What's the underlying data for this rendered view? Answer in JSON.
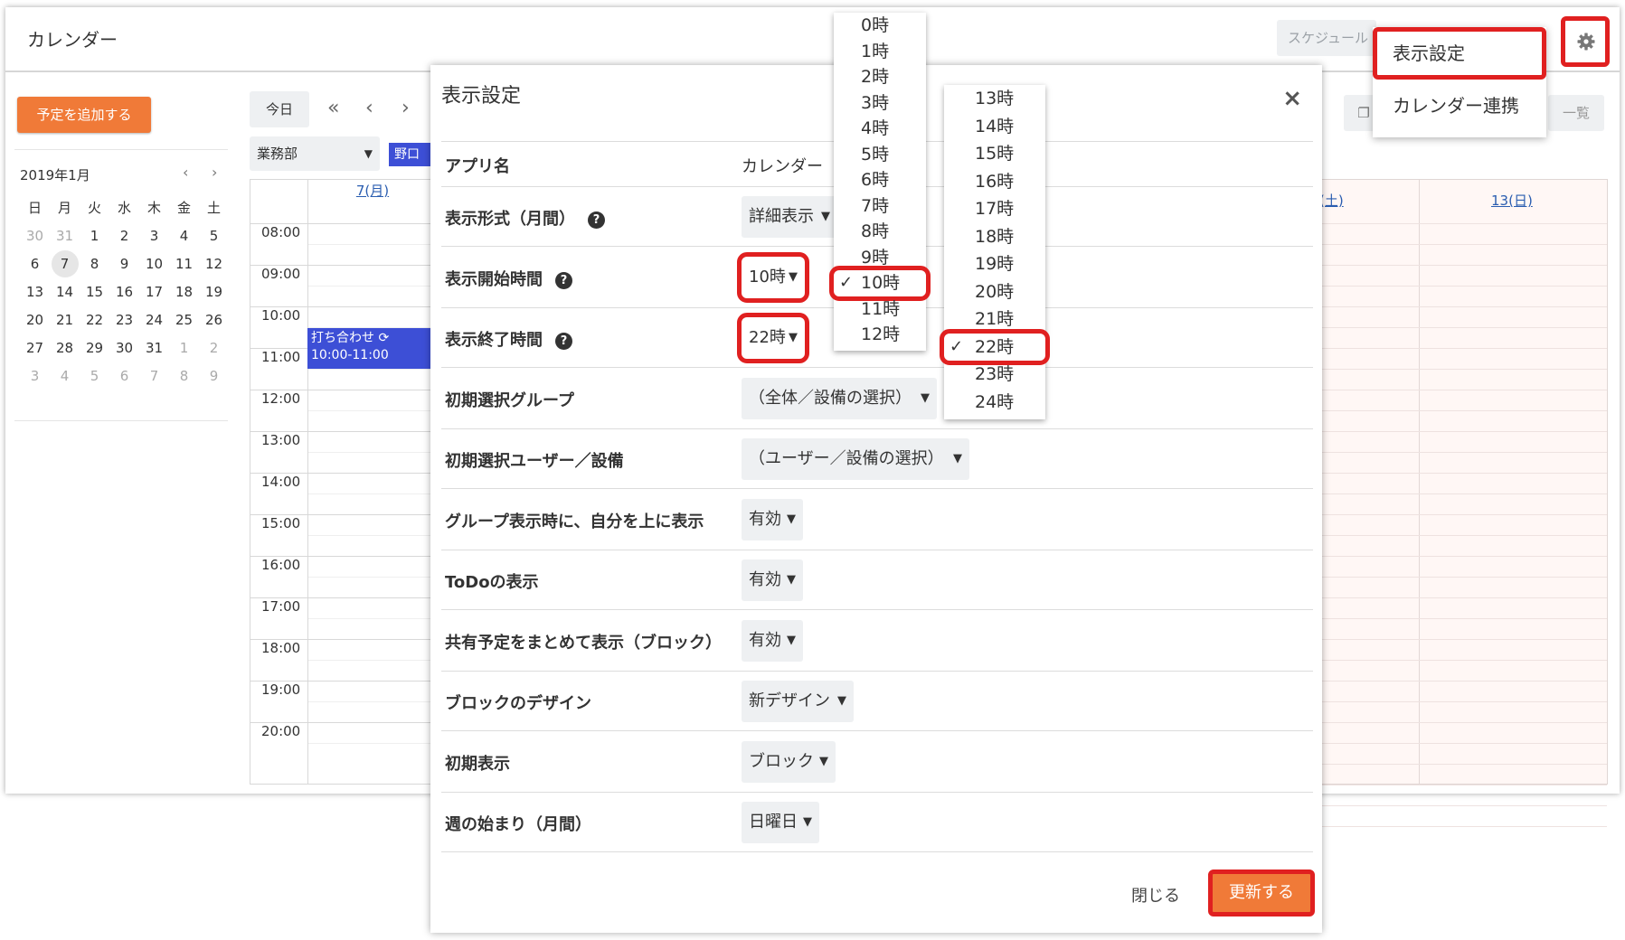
{
  "app": {
    "title": "カレンダー",
    "search_placeholder": "スケジュール"
  },
  "header": {
    "gear_icon": "gear-icon"
  },
  "settings_menu": {
    "items": [
      "表示設定",
      "カレンダー連携"
    ]
  },
  "sidebar": {
    "add_button": "予定を追加する",
    "mini_calendar": {
      "month_label": "2019年1月",
      "prev": "‹",
      "next": "›",
      "weekdays": [
        "日",
        "月",
        "火",
        "水",
        "木",
        "金",
        "土"
      ],
      "days": [
        [
          "30",
          "31",
          "1",
          "2",
          "3",
          "4",
          "5"
        ],
        [
          "6",
          "7",
          "8",
          "9",
          "10",
          "11",
          "12"
        ],
        [
          "13",
          "14",
          "15",
          "16",
          "17",
          "18",
          "19"
        ],
        [
          "20",
          "21",
          "22",
          "23",
          "24",
          "25",
          "26"
        ],
        [
          "27",
          "28",
          "29",
          "30",
          "31",
          "1",
          "2"
        ],
        [
          "3",
          "4",
          "5",
          "6",
          "7",
          "8",
          "9"
        ]
      ],
      "today": "7"
    }
  },
  "toolbar": {
    "today": "今日",
    "first": "«",
    "prev": "‹",
    "next": "›",
    "group": "業務部",
    "user_tag": "野口",
    "view_list": "一覧"
  },
  "week": {
    "day_header_left": "7(月)",
    "day_header_sat": "(土)",
    "day_header_sun": "13(日)",
    "times": [
      "08:00",
      "09:00",
      "10:00",
      "11:00",
      "12:00",
      "13:00",
      "14:00",
      "15:00",
      "16:00",
      "17:00",
      "18:00",
      "19:00",
      "20:00"
    ],
    "event": {
      "title": "打ち合わせ",
      "time": "10:00-11:00"
    }
  },
  "modal": {
    "title": "表示設定",
    "close_icon": "×",
    "rows": [
      {
        "label": "アプリ名",
        "value": "カレンダー",
        "type": "text"
      },
      {
        "label": "表示形式（月間）",
        "value": "詳細表示",
        "type": "select",
        "help": true
      },
      {
        "label": "表示開始時間",
        "value": "10時",
        "type": "select",
        "help": true
      },
      {
        "label": "表示終了時間",
        "value": "22時",
        "type": "select",
        "help": true
      },
      {
        "label": "初期選択グループ",
        "value": "（全体／設備の選択）",
        "type": "select"
      },
      {
        "label": "初期選択ユーザー／設備",
        "value": "（ユーザー／設備の選択）",
        "type": "select"
      },
      {
        "label": "グループ表示時に、自分を上に表示",
        "value": "有効",
        "type": "select"
      },
      {
        "label": "ToDoの表示",
        "value": "有効",
        "type": "select"
      },
      {
        "label": "共有予定をまとめて表示（ブロック）",
        "value": "有効",
        "type": "select"
      },
      {
        "label": "ブロックのデザイン",
        "value": "新デザイン",
        "type": "select"
      },
      {
        "label": "初期表示",
        "value": "ブロック",
        "type": "select"
      },
      {
        "label": "週の始まり（月間）",
        "value": "日曜日",
        "type": "select"
      }
    ],
    "close_label": "閉じる",
    "update_label": "更新する"
  },
  "start_hour_options": [
    "0時",
    "1時",
    "2時",
    "3時",
    "4時",
    "5時",
    "6時",
    "7時",
    "8時",
    "9時",
    "10時",
    "11時",
    "12時"
  ],
  "start_hour_selected": "10時",
  "end_hour_options": [
    "13時",
    "14時",
    "15時",
    "16時",
    "17時",
    "18時",
    "19時",
    "20時",
    "21時",
    "22時",
    "23時",
    "24時"
  ],
  "end_hour_selected": "22時",
  "colors": {
    "accent_orange": "#f07a38",
    "highlight_red": "#e02020",
    "event_blue": "#3d4fd6"
  }
}
